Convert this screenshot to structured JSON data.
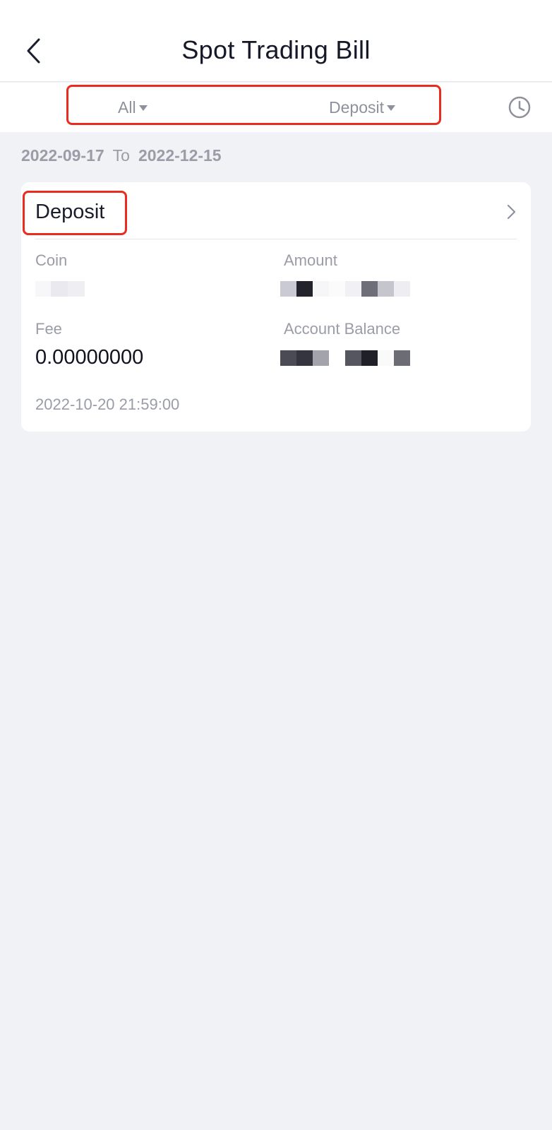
{
  "header": {
    "title": "Spot Trading Bill",
    "back_icon": "chevron-left-icon"
  },
  "filters": {
    "account_filter": "All",
    "type_filter": "Deposit",
    "history_icon": "clock-icon",
    "highlight_color": "#ea2b1f"
  },
  "date_range": {
    "start": "2022-09-17",
    "separator": "To",
    "end": "2022-12-15"
  },
  "records": [
    {
      "type": "Deposit",
      "coin_label": "Coin",
      "coin_value": "",
      "amount_label": "Amount",
      "amount_value": "",
      "fee_label": "Fee",
      "fee_value": "0.00000000",
      "balance_label": "Account Balance",
      "balance_value": "",
      "timestamp": "2022-10-20 21:59:00"
    }
  ],
  "colors": {
    "background": "#f1f2f5",
    "card": "#ffffff",
    "muted_text": "#9a9da8",
    "highlight": "#ea2b1f"
  }
}
